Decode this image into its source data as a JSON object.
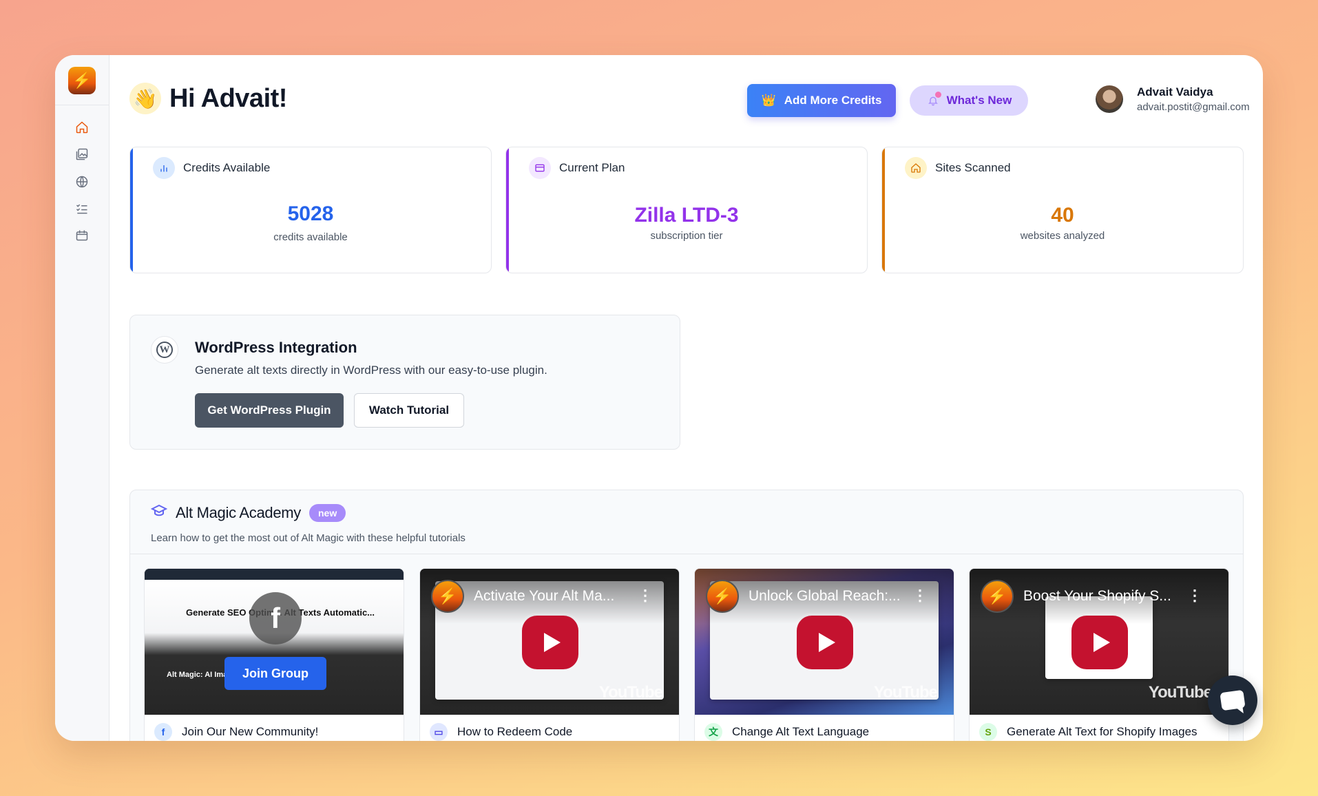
{
  "greeting": {
    "emoji": "👋",
    "text": "Hi Advait!"
  },
  "header": {
    "add_credits_label": "Add More Credits",
    "whats_new_label": "What's New",
    "user": {
      "name": "Advait Vaidya",
      "email": "advait.postit@gmail.com"
    }
  },
  "sidebar": {
    "items": [
      {
        "icon": "home-icon",
        "active": true
      },
      {
        "icon": "images-icon",
        "active": false
      },
      {
        "icon": "globe-icon",
        "active": false
      },
      {
        "icon": "checklist-icon",
        "active": false
      },
      {
        "icon": "calendar-icon",
        "active": false
      }
    ]
  },
  "stats": [
    {
      "title": "Credits Available",
      "value": "5028",
      "sub": "credits available",
      "accent": "#2563eb",
      "soft": "#dbeafe",
      "icon": "bar-chart-icon"
    },
    {
      "title": "Current Plan",
      "value": "Zilla LTD-3",
      "sub": "subscription tier",
      "accent": "#9333ea",
      "soft": "#f3e8ff",
      "icon": "card-icon"
    },
    {
      "title": "Sites Scanned",
      "value": "40",
      "sub": "websites analyzed",
      "accent": "#d97706",
      "soft": "#fef3c7",
      "icon": "home-icon"
    }
  ],
  "wordpress": {
    "title": "WordPress Integration",
    "description": "Generate alt texts directly in WordPress with our easy-to-use plugin.",
    "primary_label": "Get WordPress Plugin",
    "secondary_label": "Watch Tutorial"
  },
  "academy": {
    "title": "Alt Magic Academy",
    "badge": "new",
    "description": "Learn how to get the most out of Alt Magic with these helpful tutorials",
    "videos": [
      {
        "label": "Join Our New Community!",
        "icon": "facebook-icon",
        "join_label": "Join Group",
        "hero_text": "Generate SEO Optim... Alt Texts Automatic...",
        "caption": "Alt Magic: AI Imag..."
      },
      {
        "label": "How to Redeem Code",
        "icon": "ticket-icon",
        "video_title": "Activate Your Alt Ma...",
        "yt": "YouTube"
      },
      {
        "label": "Change Alt Text Language",
        "icon": "translate-icon",
        "video_title": "Unlock Global Reach:...",
        "yt": "YouTube"
      },
      {
        "label": "Generate Alt Text for Shopify Images",
        "icon": "shopify-icon",
        "video_title": "Boost Your Shopify S...",
        "yt": "YouTube"
      }
    ]
  },
  "colors": {
    "brand_orange": "#ea580c",
    "primary_blue": "#3b82f6",
    "purple": "#6d28d9"
  }
}
